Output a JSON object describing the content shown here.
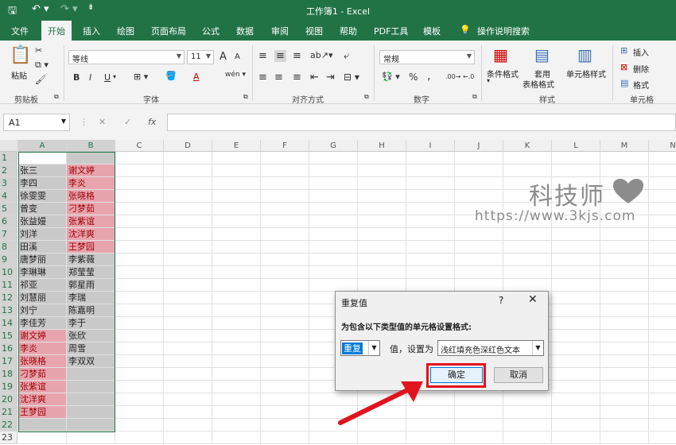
{
  "window": {
    "title": "工作簿1  -  Excel",
    "save_icon": "save-icon",
    "undo_icon": "undo-icon",
    "redo_icon": "redo-icon"
  },
  "tabs": [
    "文件",
    "开始",
    "插入",
    "绘图",
    "页面布局",
    "公式",
    "数据",
    "审阅",
    "视图",
    "帮助",
    "PDF工具",
    "模板",
    "操作说明搜索"
  ],
  "active_tab": "开始",
  "ribbon": {
    "clipboard": {
      "paste": "粘贴",
      "label": "剪贴板"
    },
    "font": {
      "name": "等线",
      "size": "11",
      "label": "字体",
      "grow": "A",
      "shrink": "A",
      "bold": "B",
      "italic": "I",
      "underline": "U"
    },
    "align": {
      "label": "对齐方式"
    },
    "number": {
      "format": "常规",
      "percent": "%",
      "comma": ",",
      "label": "数字"
    },
    "styles": {
      "cond_format": "条件格式",
      "table_format_1": "套用",
      "table_format_2": "表格格式",
      "cell_style": "单元格样式",
      "label": "样式"
    },
    "cells": {
      "insert": "插入",
      "delete": "删除",
      "format": "格式",
      "label": "单元格"
    }
  },
  "formula_bar": {
    "name_box": "A1",
    "fx": "fx",
    "value": ""
  },
  "columns": [
    "A",
    "B",
    "C",
    "D",
    "E",
    "F",
    "G",
    "H",
    "I",
    "J",
    "K",
    "L",
    "M",
    "N"
  ],
  "rows": [
    "1",
    "2",
    "3",
    "4",
    "5",
    "6",
    "7",
    "8",
    "9",
    "10",
    "11",
    "12",
    "13",
    "14",
    "15",
    "16",
    "17",
    "18",
    "19",
    "20",
    "21",
    "22",
    "23"
  ],
  "column_a": [
    "",
    "张三",
    "李四",
    "徐雯雯",
    "曾变",
    "张益嫚",
    "刘洋",
    "田溪",
    "唐梦丽",
    "李琳琳",
    "祁亚",
    "刘慧丽",
    "刘宁",
    "李佳芳",
    "谢文婷",
    "李炎",
    "张晓格",
    "刁梦茹",
    "张紫谊",
    "沈洋爽",
    "王梦园",
    ""
  ],
  "column_b": [
    "",
    "谢文婷",
    "李炎",
    "张晓格",
    "刁梦茹",
    "张紫谊",
    "沈洋爽",
    "王梦园",
    "李紫薇",
    "郑莹莹",
    "郭星雨",
    "李瑞",
    "陈嘉明",
    "李于",
    "张欣",
    "周雪",
    "李双双",
    "",
    "",
    "",
    "",
    ""
  ],
  "dup_a": [
    15,
    16,
    17,
    18,
    19,
    20,
    21
  ],
  "dup_b": [
    2,
    3,
    4,
    5,
    6,
    7,
    8
  ],
  "watermark": {
    "brand": "科技师",
    "url": "https://www.3kjs.com"
  },
  "dialog": {
    "title": "重复值",
    "help": "?",
    "close": "✕",
    "prompt": "为包含以下类型值的单元格设置格式:",
    "type_value": "重复",
    "middle_text": "值，设置为",
    "format_value": "浅红填充色深红色文本",
    "ok": "确定",
    "cancel": "取消"
  },
  "colors": {
    "excel_green": "#217346",
    "dup_fill": "#e8a4ad",
    "dup_text": "#9c0006",
    "highlight_red": "#e0141e"
  }
}
